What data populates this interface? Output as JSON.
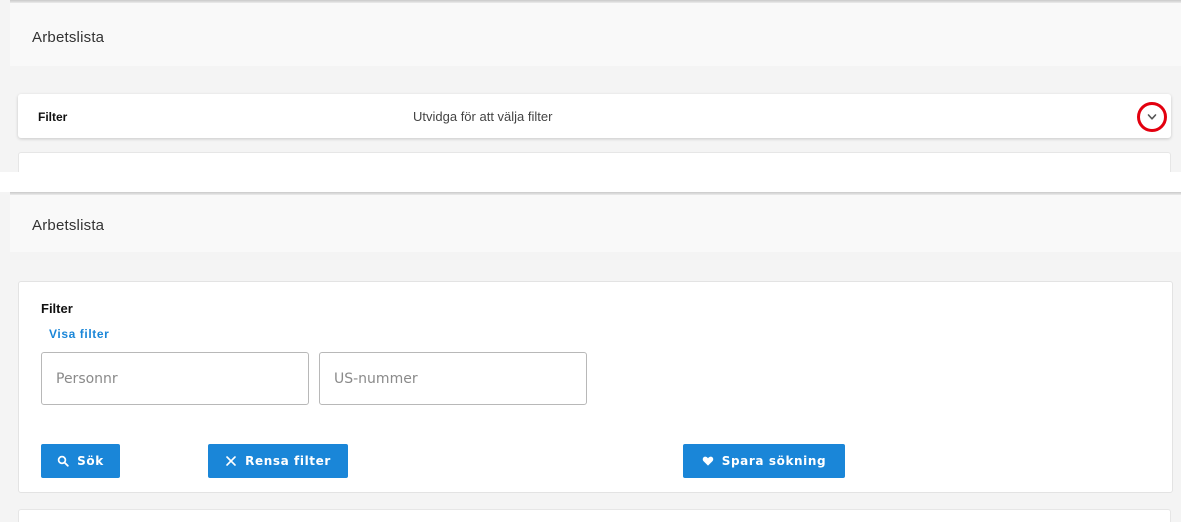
{
  "collapsed": {
    "page_title": "Arbetslista",
    "filter_label": "Filter",
    "filter_hint": "Utvidga för att välja filter",
    "expand_icon": "chevron-down-icon"
  },
  "expanded": {
    "page_title": "Arbetslista",
    "filter_label": "Filter",
    "visa_filter": "Visa filter",
    "personnr": {
      "value": "",
      "placeholder": "Personnr"
    },
    "us_nummer": {
      "value": "",
      "placeholder": "US-nummer"
    },
    "buttons": {
      "sok": {
        "label": "Sök",
        "icon": "search-icon"
      },
      "rensa": {
        "label": "Rensa filter",
        "icon": "close-icon"
      },
      "spara": {
        "label": "Spara sökning",
        "icon": "heart-icon"
      }
    }
  },
  "colors": {
    "accent": "#1a86d8",
    "highlight_ring": "#e3000f",
    "background": "#f4f4f4"
  }
}
